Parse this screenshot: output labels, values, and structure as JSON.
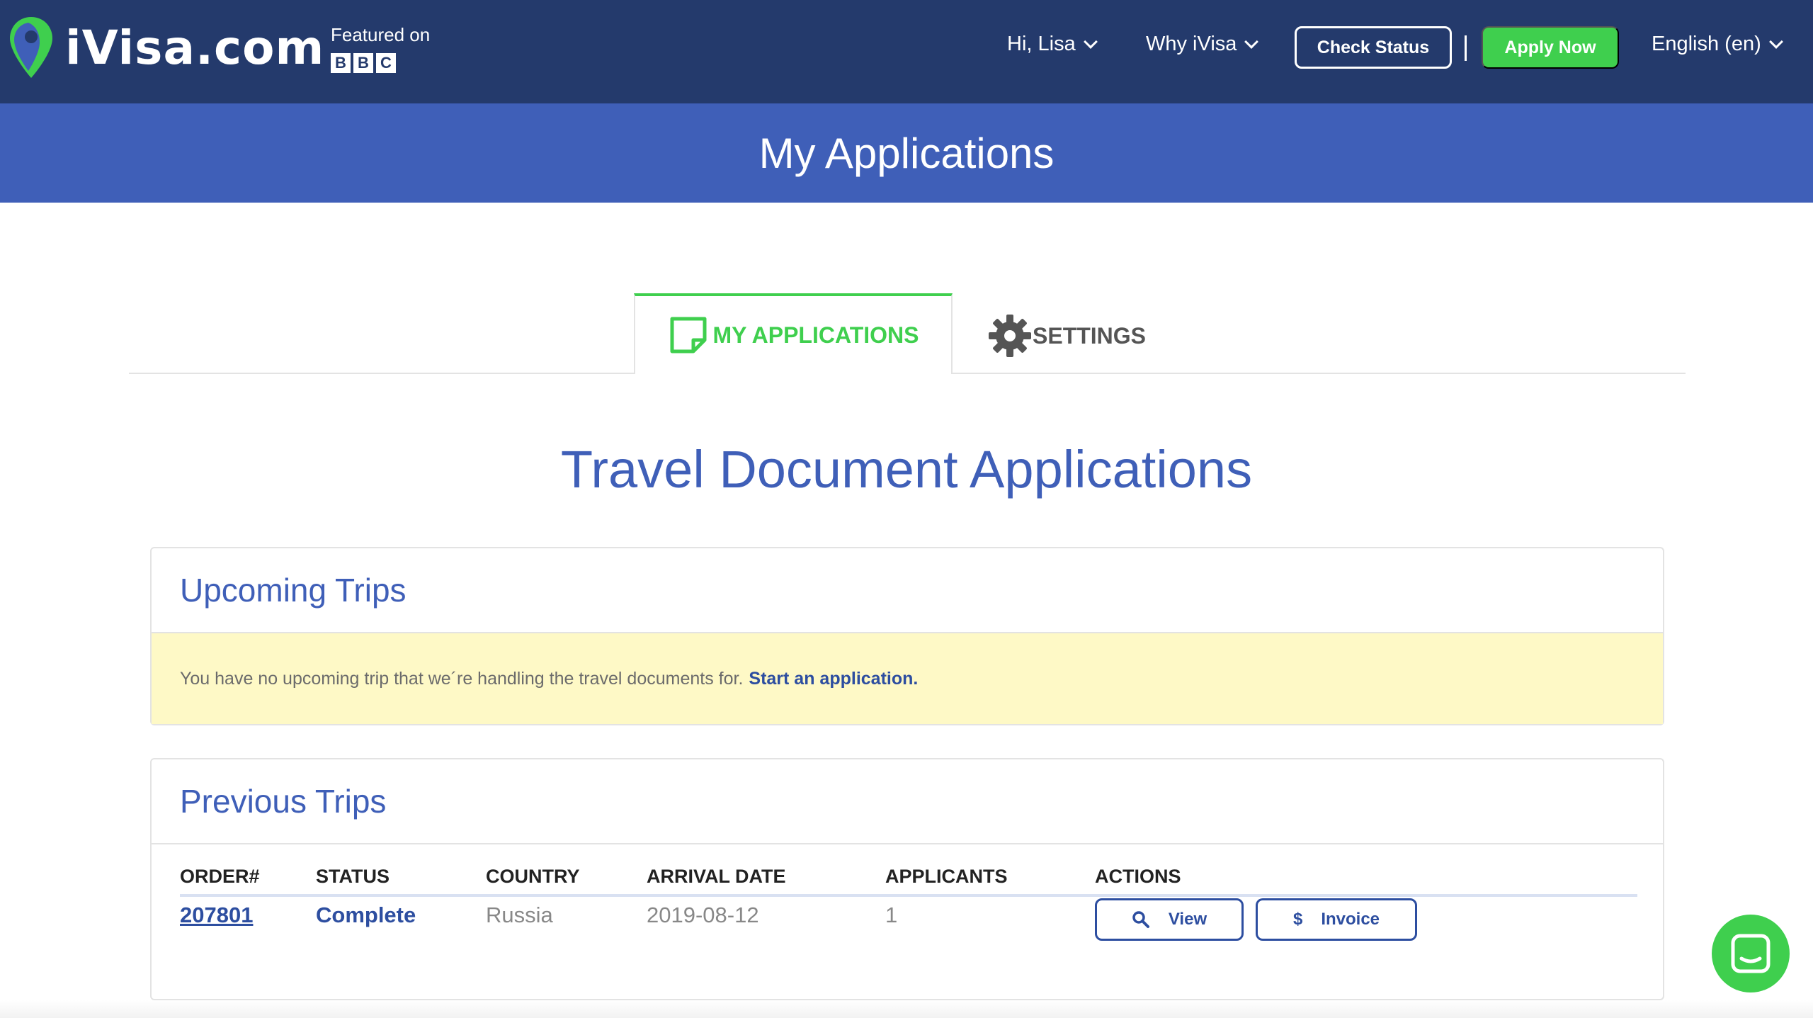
{
  "header": {
    "logo_text": "iVisa.com",
    "featured_label": "Featured on",
    "featured_brand": [
      "B",
      "B",
      "C"
    ],
    "user_menu": "Hi, Lisa",
    "why_menu": "Why iVisa",
    "check_status": "Check Status",
    "apply_now": "Apply Now",
    "language": "English (en)"
  },
  "banner": {
    "title": "My Applications"
  },
  "tabs": [
    {
      "label": "MY APPLICATIONS",
      "active": true
    },
    {
      "label": "SETTINGS",
      "active": false
    }
  ],
  "main": {
    "heading": "Travel Document Applications"
  },
  "upcoming": {
    "title": "Upcoming Trips",
    "notice_text": "You have no upcoming trip that we´re handling the travel documents for.",
    "notice_link": "Start an application."
  },
  "previous": {
    "title": "Previous Trips",
    "columns": [
      "ORDER#",
      "STATUS",
      "COUNTRY",
      "ARRIVAL DATE",
      "APPLICANTS",
      "ACTIONS"
    ],
    "rows": [
      {
        "order": "207801",
        "status": "Complete",
        "country": "Russia",
        "arrival_date": "2019-08-12",
        "applicants": "1",
        "actions": [
          {
            "label": "View",
            "icon": "search-icon"
          },
          {
            "label": "Invoice",
            "icon": "dollar-icon"
          }
        ]
      }
    ]
  },
  "colors": {
    "nav_bg": "#243a6c",
    "banner_bg": "#3f5fb8",
    "accent_green": "#3fcf4e",
    "link_blue": "#2d4ea0",
    "notice_bg": "#fef9c6"
  }
}
